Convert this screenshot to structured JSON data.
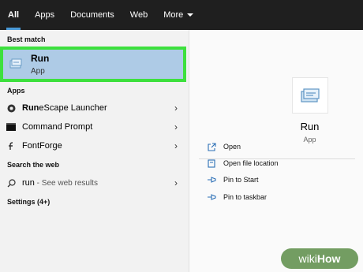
{
  "tabs": [
    {
      "label": "All",
      "active": true
    },
    {
      "label": "Apps"
    },
    {
      "label": "Documents"
    },
    {
      "label": "Web"
    },
    {
      "label": "More"
    }
  ],
  "left": {
    "best_match_label": "Best match",
    "best_match": {
      "title": "Run",
      "subtitle": "App",
      "icon": "run-app-icon",
      "highlight_color": "#3de03d",
      "selected_bg": "#aecbe6"
    },
    "apps_label": "Apps",
    "apps": [
      {
        "bold": "Run",
        "rest": "eScape Launcher",
        "icon": "runescape-icon"
      },
      {
        "bold": "",
        "rest": "Command Prompt",
        "icon": "command-prompt-icon"
      },
      {
        "bold": "",
        "rest": "FontForge",
        "icon": "fontforge-icon"
      }
    ],
    "web_label": "Search the web",
    "web": {
      "query": "run",
      "suffix": " - See web results"
    },
    "settings_label": "Settings (4+)"
  },
  "right": {
    "title": "Run",
    "subtitle": "App",
    "actions": [
      {
        "label": "Open",
        "icon": "open-icon"
      },
      {
        "label": "Open file location",
        "icon": "file-location-icon"
      },
      {
        "label": "Pin to Start",
        "icon": "pin-icon"
      },
      {
        "label": "Pin to taskbar",
        "icon": "pin-icon"
      }
    ]
  },
  "watermark": {
    "part1": "wiki",
    "part2": "How"
  }
}
